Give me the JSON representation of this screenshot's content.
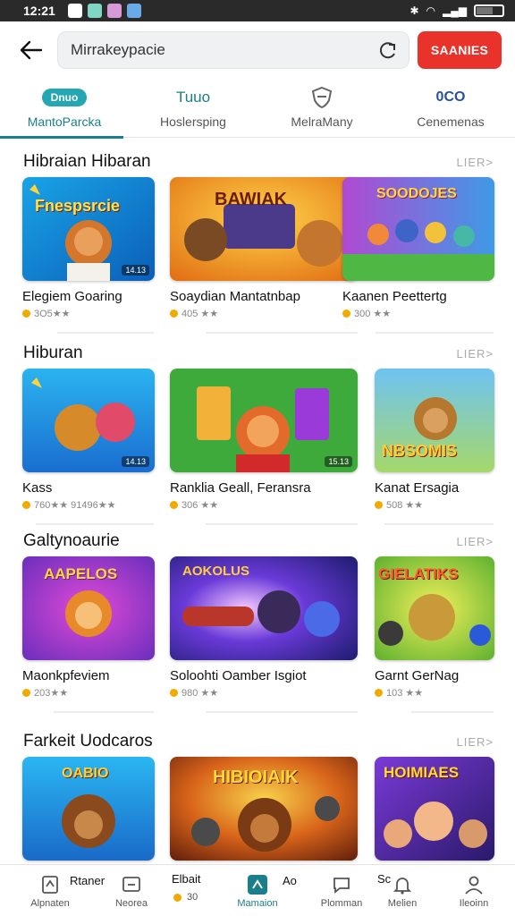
{
  "status_bar": {
    "time": "12:21",
    "battery": ""
  },
  "search": {
    "value": "Mirrakeypacie",
    "button_label": "SAANIES"
  },
  "tabs": [
    {
      "badge": "Dnuo",
      "label": "MantoParcka"
    },
    {
      "badge": "Tuuo",
      "label": "Hoslersping"
    },
    {
      "badge": "",
      "label": "MelraMany"
    },
    {
      "badge": "0CO",
      "label": "Cenemenas"
    }
  ],
  "sections": [
    {
      "title": "Hibraian Hibaran",
      "more": "LIER>",
      "cards": [
        {
          "art_title": "Fnespsrcie",
          "title": "Elegiem Goaring",
          "meta": "3O5★★",
          "badge": "14.13"
        },
        {
          "art_title": "BAWIAK",
          "title": "Soaydian Mantatnbap",
          "meta": "405 ★★",
          "badge": ""
        },
        {
          "art_title": "SOODOJES",
          "title": "Kaanen Peettertg",
          "meta": "300 ★★",
          "badge": ""
        }
      ]
    },
    {
      "title": "Hiburan",
      "more": "LIER>",
      "cards": [
        {
          "art_title": "",
          "title": "Kass",
          "meta": "760★★ 91496★★",
          "badge": "14.13"
        },
        {
          "art_title": "",
          "title": "Ranklia Geall, Feransra",
          "meta": "306 ★★",
          "badge": "15.13"
        },
        {
          "art_title": "NBSOMIS",
          "title": "Kanat Ersagia",
          "meta": "508 ★★",
          "badge": ""
        }
      ]
    },
    {
      "title": "Galtynoaurie",
      "more": "LIER>",
      "cards": [
        {
          "art_title": "AAPELOS",
          "title": "Maonkpfeviem",
          "meta": "203★★",
          "badge": ""
        },
        {
          "art_title": "AOKOLUS",
          "title": "Soloohti Oamber Isgiot",
          "meta": "980 ★★",
          "badge": ""
        },
        {
          "art_title": "GIELATIKS",
          "title": "Garnt GerNag",
          "meta": "103 ★★",
          "badge": ""
        }
      ]
    },
    {
      "title": "Farkeit Uodcaros",
      "more": "LIER>",
      "cards": [
        {
          "art_title": "OABIO",
          "title": "",
          "meta": "",
          "badge": ""
        },
        {
          "art_title": "HIBIOIAIK",
          "title": "",
          "meta": "",
          "badge": ""
        },
        {
          "art_title": "HOIMIAES",
          "title": "",
          "meta": "",
          "badge": ""
        }
      ]
    }
  ],
  "bottom_nav": [
    {
      "label": "Alpnaten",
      "overlay": "Rtaner"
    },
    {
      "label": "Neorea",
      "overlay": ""
    },
    {
      "label": "",
      "overlay": "Elbait",
      "sub": "30"
    },
    {
      "label": "Mamaion",
      "overlay": "Ao"
    },
    {
      "label": "Plomman",
      "overlay": ""
    },
    {
      "label": "Melien",
      "overlay": "Sc"
    },
    {
      "label": "Ileoinn",
      "overlay": ""
    }
  ],
  "colors": {
    "accent": "#1a7f8a",
    "button": "#e8322a",
    "star": "#f2a900"
  }
}
